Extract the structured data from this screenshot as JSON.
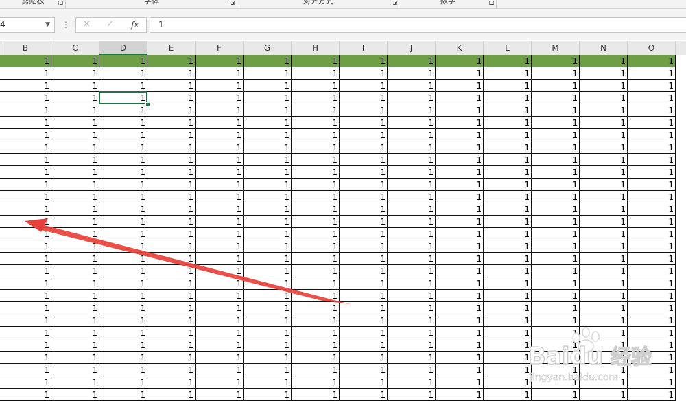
{
  "ribbon": {
    "groups": [
      {
        "name": "clipboard",
        "label": "剪贴板"
      },
      {
        "name": "font",
        "label": "字体"
      },
      {
        "name": "alignment",
        "label": "对齐方式"
      },
      {
        "name": "number",
        "label": "数字"
      }
    ]
  },
  "formula_bar": {
    "name_box": "4",
    "dots": "⋮",
    "cancel_glyph": "✕",
    "enter_glyph": "✓",
    "fx_label": "fx",
    "value": "1"
  },
  "sheet": {
    "columns": [
      "B",
      "C",
      "D",
      "E",
      "F",
      "G",
      "H",
      "I",
      "J",
      "K",
      "L",
      "M",
      "N",
      "O"
    ],
    "selected_column": "D",
    "selected_row_index": 3,
    "highlighted_row_index": 0,
    "highlight_color": "#6e9e45",
    "selection_color": "#217346",
    "visible_rows": 28,
    "cell_value": "1"
  },
  "annotation": {
    "arrow_color": "#e8403a"
  },
  "watermark": {
    "brand": "Baidu",
    "label": "经验",
    "url": "jingyan.baidu.com"
  }
}
